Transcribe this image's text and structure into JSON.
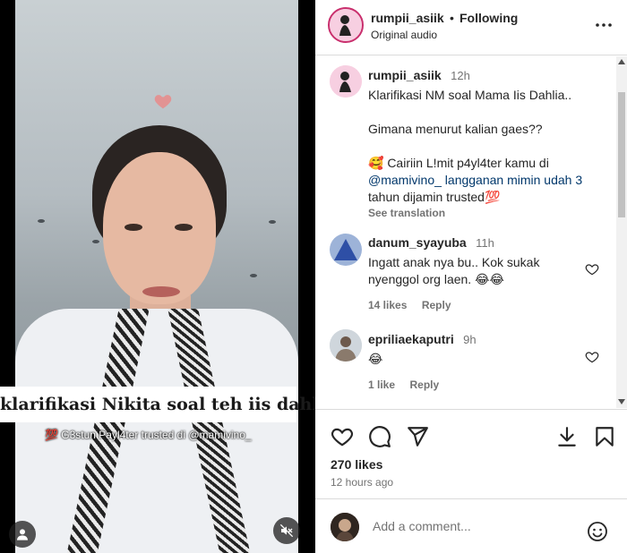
{
  "post": {
    "username": "rumpii_asiik",
    "separator": "•",
    "follow_status": "Following",
    "audio": "Original audio",
    "video_caption": "klarifikasi Nikita soal teh iis dahlia",
    "video_subcaption": "💯 G3stun Payl4ter trusted di @mamivino_"
  },
  "caption": {
    "username": "rumpii_asiik",
    "time": "12h",
    "line1": "Klarifikasi NM soal Mama Iis Dahlia..",
    "line2": "Gimana menurut kalian gaes??",
    "line3": "🥰 Cairiin L!mit p4yl4ter kamu di",
    "line4": "@mamivino_ langganan mimin udah 3",
    "line5": "tahun dijamin trusted💯",
    "see_translation": "See translation"
  },
  "comments": [
    {
      "username": "danum_syayuba",
      "time": "11h",
      "text_line1": "Ingatt anak nya bu.. Kok sukak",
      "text_line2": "nyenggol org laen. 😂😂",
      "likes": "14 likes",
      "reply": "Reply"
    },
    {
      "username": "epriliaekaputri",
      "time": "9h",
      "text_line1": "😂",
      "likes": "1 like",
      "reply": "Reply"
    }
  ],
  "stats": {
    "likes": "270 likes",
    "time_ago": "12 hours ago"
  },
  "comment_box": {
    "placeholder": "Add a comment..."
  },
  "icons": {
    "more": "more-options-icon",
    "like": "heart-icon",
    "comment": "comment-icon",
    "share": "send-icon",
    "download": "download-icon",
    "save": "bookmark-icon",
    "emoji": "emoji-icon",
    "mute": "mute-icon",
    "user_tag": "user-tag-icon"
  },
  "colors": {
    "ring": "#c92f6d",
    "link": "#00376b",
    "muted": "#737373"
  }
}
